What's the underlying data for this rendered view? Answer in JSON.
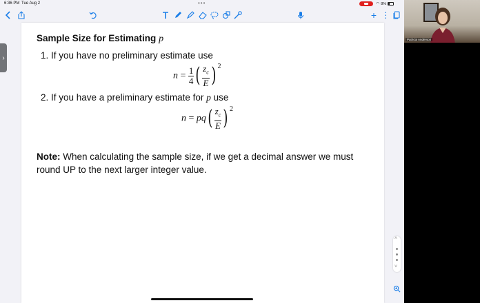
{
  "status_bar": {
    "time": "6:36 PM",
    "date": "Tue Aug 2",
    "battery": "8%"
  },
  "toolbar": {
    "back_icon": "chevron-left-icon",
    "share_icon": "share-icon",
    "undo_icon": "undo-icon",
    "tools": [
      "text-tool-icon",
      "pen-icon",
      "highlighter-icon",
      "eraser-icon",
      "lasso-icon",
      "shapes-icon",
      "magic-wand-icon"
    ],
    "mic_icon": "microphone-icon",
    "add_label": "+",
    "more_label": "⋮",
    "pages_icon": "pages-icon",
    "accent": "#1a7ee8"
  },
  "document": {
    "title": "Sample Size for Estimating",
    "title_var": "p",
    "item1": "1. If you have no preliminary estimate use",
    "item2_prefix": "2. If you have a preliminary estimate for",
    "item2_var": "p",
    "item2_suffix": "use",
    "formula1": {
      "lhs": "n",
      "eq": "=",
      "frac_num": "1",
      "frac_den": "4",
      "inner_num": "z",
      "inner_num_sub": "c",
      "inner_den": "E",
      "exponent": "2"
    },
    "formula2": {
      "lhs": "n",
      "eq": "=",
      "coef": "pq",
      "inner_num": "z",
      "inner_num_sub": "c",
      "inner_den": "E",
      "exponent": "2"
    },
    "note_label": "Note:",
    "note_text": "When calculating the sample size, if we get a decimal answer we must round UP to the next larger integer value."
  },
  "video": {
    "participant_name": "Patricia Anderson"
  }
}
